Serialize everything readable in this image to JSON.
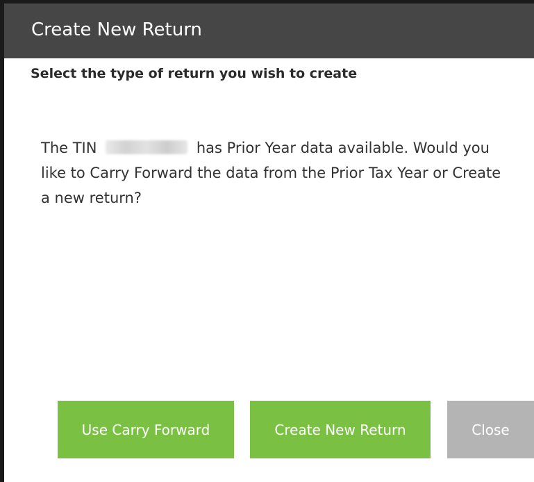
{
  "dialog": {
    "title": "Create New Return",
    "subtitle": "Select the type of return you wish to create",
    "message_prefix": "The TIN",
    "tin_masked": "XXX-XX-XXXX",
    "message_suffix": "has Prior Year data available. Would you like to Carry Forward the data from the Prior Tax Year or Create a new return?"
  },
  "buttons": {
    "carry_forward": "Use Carry Forward",
    "create_new": "Create New Return",
    "close": "Close"
  },
  "colors": {
    "titlebar": "#464646",
    "primary_button": "#7ac143",
    "secondary_button": "#b4b4b4",
    "border": "#1a1a1a"
  }
}
